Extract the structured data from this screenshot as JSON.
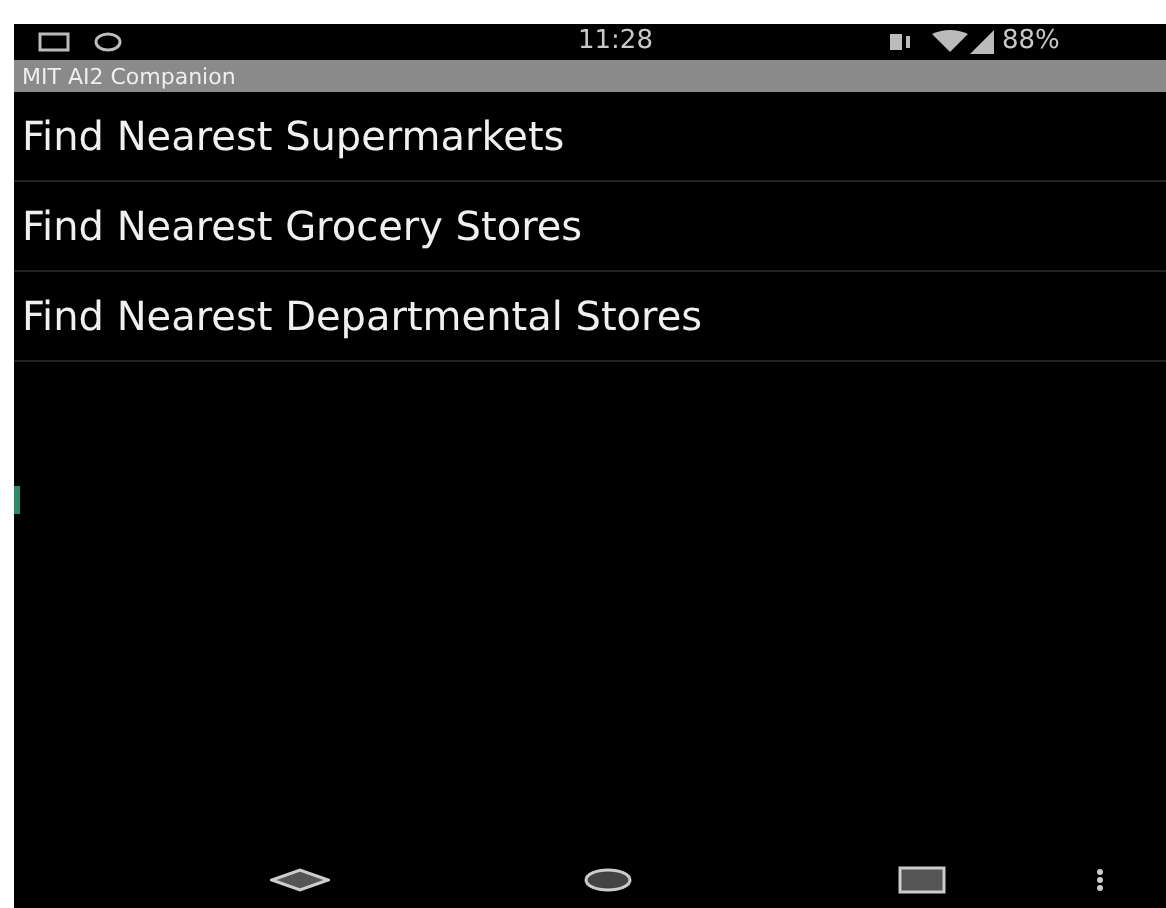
{
  "status_bar": {
    "time": "11:28",
    "battery": "88%"
  },
  "title_bar": {
    "title": "MIT AI2 Companion"
  },
  "items": [
    {
      "label": "Find Nearest Supermarkets"
    },
    {
      "label": "Find Nearest Grocery Stores"
    },
    {
      "label": "Find Nearest Departmental Stores"
    }
  ]
}
